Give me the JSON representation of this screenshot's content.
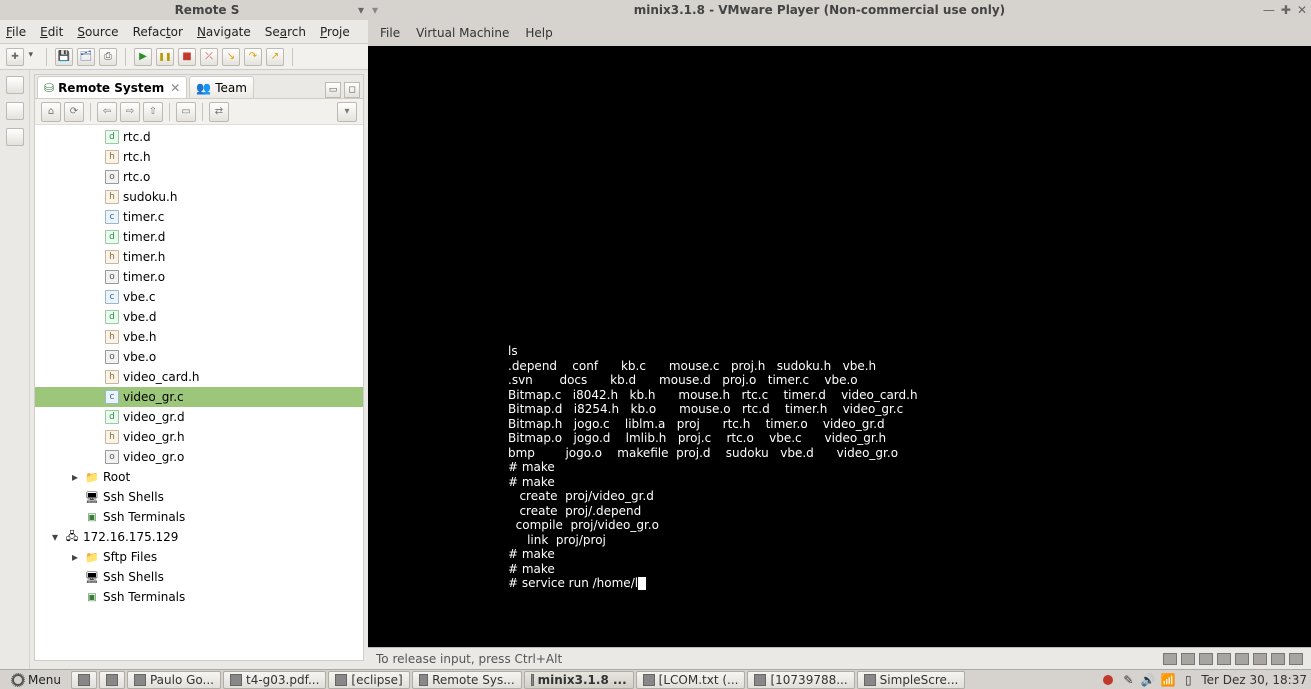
{
  "eclipse": {
    "title": "Remote S",
    "menus": [
      "File",
      "Edit",
      "Source",
      "Refactor",
      "Navigate",
      "Search",
      "Proje"
    ],
    "toolbar_icons": [
      "new",
      "save",
      "saveall",
      "print",
      "run",
      "pause",
      "stop",
      "disc",
      "into",
      "over",
      "out"
    ],
    "panel": {
      "tabs": [
        {
          "label": "Remote System",
          "active": true,
          "closable": true
        },
        {
          "label": "Team",
          "active": false,
          "closable": false
        }
      ],
      "files": [
        {
          "name": "rtc.d",
          "ico": "d"
        },
        {
          "name": "rtc.h",
          "ico": "h"
        },
        {
          "name": "rtc.o",
          "ico": "o"
        },
        {
          "name": "sudoku.h",
          "ico": "h"
        },
        {
          "name": "timer.c",
          "ico": "c"
        },
        {
          "name": "timer.d",
          "ico": "d"
        },
        {
          "name": "timer.h",
          "ico": "h"
        },
        {
          "name": "timer.o",
          "ico": "o"
        },
        {
          "name": "vbe.c",
          "ico": "c"
        },
        {
          "name": "vbe.d",
          "ico": "d"
        },
        {
          "name": "vbe.h",
          "ico": "h"
        },
        {
          "name": "vbe.o",
          "ico": "o"
        },
        {
          "name": "video_card.h",
          "ico": "h"
        },
        {
          "name": "video_gr.c",
          "ico": "c",
          "selected": true
        },
        {
          "name": "video_gr.d",
          "ico": "d"
        },
        {
          "name": "video_gr.h",
          "ico": "h"
        },
        {
          "name": "video_gr.o",
          "ico": "o"
        }
      ],
      "nodes": [
        {
          "name": "Root",
          "ico": "folder",
          "depth": 1,
          "arrow": "▸"
        },
        {
          "name": "Ssh Shells",
          "ico": "shell",
          "depth": 1
        },
        {
          "name": "Ssh Terminals",
          "ico": "term",
          "depth": 1
        },
        {
          "name": "172.16.175.129",
          "ico": "host",
          "depth": 0,
          "arrow": "▾"
        },
        {
          "name": "Sftp Files",
          "ico": "folder",
          "depth": 1,
          "arrow": "▸"
        },
        {
          "name": "Ssh Shells",
          "ico": "shell",
          "depth": 1
        },
        {
          "name": "Ssh Terminals",
          "ico": "term",
          "depth": 1
        }
      ]
    }
  },
  "vmware": {
    "title": "minix3.1.8 - VMware Player (Non-commercial use only)",
    "menus": [
      "File",
      "Virtual Machine",
      "Help"
    ],
    "status": "To release input, press Ctrl+Alt",
    "terminal_lines": [
      "ls",
      ".depend    conf      kb.c      mouse.c   proj.h   sudoku.h   vbe.h",
      ".svn       docs      kb.d      mouse.d   proj.o   timer.c    vbe.o",
      "Bitmap.c   i8042.h   kb.h      mouse.h   rtc.c    timer.d    video_card.h",
      "Bitmap.d   i8254.h   kb.o      mouse.o   rtc.d    timer.h    video_gr.c",
      "Bitmap.h   jogo.c    liblm.a   proj      rtc.h    timer.o    video_gr.d",
      "Bitmap.o   jogo.d    lmlib.h   proj.c    rtc.o    vbe.c      video_gr.h",
      "bmp        jogo.o    makefile  proj.d    sudoku   vbe.d      video_gr.o",
      "# make",
      "# make",
      "   create  proj/video_gr.d",
      "   create  proj/.depend",
      "  compile  proj/video_gr.o",
      "     link  proj/proj",
      "# make",
      "# make",
      "# service run /home/l"
    ]
  },
  "taskbar": {
    "menu_label": "Menu",
    "items": [
      {
        "label": "Paulo Go..."
      },
      {
        "label": "t4-g03.pdf..."
      },
      {
        "label": "[eclipse]"
      },
      {
        "label": "Remote Sys..."
      },
      {
        "label": "minix3.1.8 ...",
        "active": true
      },
      {
        "label": "[LCOM.txt (..."
      },
      {
        "label": "[10739788..."
      },
      {
        "label": "SimpleScre..."
      }
    ],
    "clock": "Ter Dez 30, 18:37"
  }
}
